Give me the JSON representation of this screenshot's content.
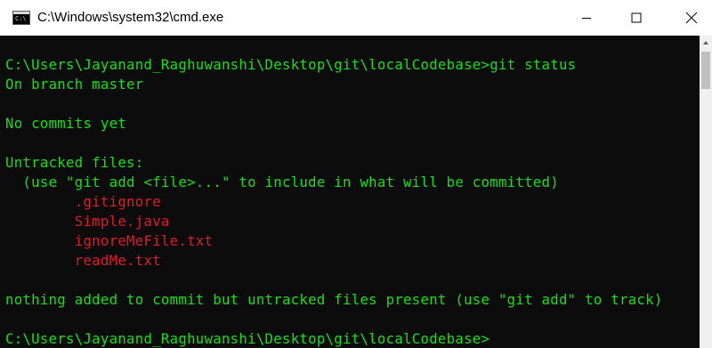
{
  "window": {
    "title": "C:\\Windows\\system32\\cmd.exe",
    "app_icon_text": "C:\\"
  },
  "console": {
    "lines": [
      {
        "text": "C:\\Users\\Jayanand_Raghuwanshi\\Desktop\\git\\localCodebase>git status",
        "color": "#15e115"
      },
      {
        "text": "On branch master",
        "color": "#15e115"
      },
      {
        "text": "",
        "color": "#15e115"
      },
      {
        "text": "No commits yet",
        "color": "#15e115"
      },
      {
        "text": "",
        "color": "#15e115"
      },
      {
        "text": "Untracked files:",
        "color": "#15e115"
      },
      {
        "text": "  (use \"git add <file>...\" to include in what will be committed)",
        "color": "#15e115"
      },
      {
        "text": "        .gitignore",
        "color": "#e01b2a"
      },
      {
        "text": "        Simple.java",
        "color": "#e01b2a"
      },
      {
        "text": "        ignoreMeFile.txt",
        "color": "#e01b2a"
      },
      {
        "text": "        readMe.txt",
        "color": "#e01b2a"
      },
      {
        "text": "",
        "color": "#15e115"
      },
      {
        "text": "nothing added to commit but untracked files present (use \"git add\" to track)",
        "color": "#15e115"
      },
      {
        "text": "",
        "color": "#15e115"
      },
      {
        "text": "C:\\Users\\Jayanand_Raghuwanshi\\Desktop\\git\\localCodebase>",
        "color": "#15e115"
      }
    ]
  },
  "icons": {
    "minimize": "minimize-icon",
    "maximize": "maximize-icon",
    "close": "close-icon",
    "scroll_up": "chevron-up-icon"
  },
  "colors": {
    "console_bg": "#0c0c0c",
    "text_green": "#15e115",
    "text_red": "#e01b2a",
    "titlebar_bg": "#ffffff"
  }
}
